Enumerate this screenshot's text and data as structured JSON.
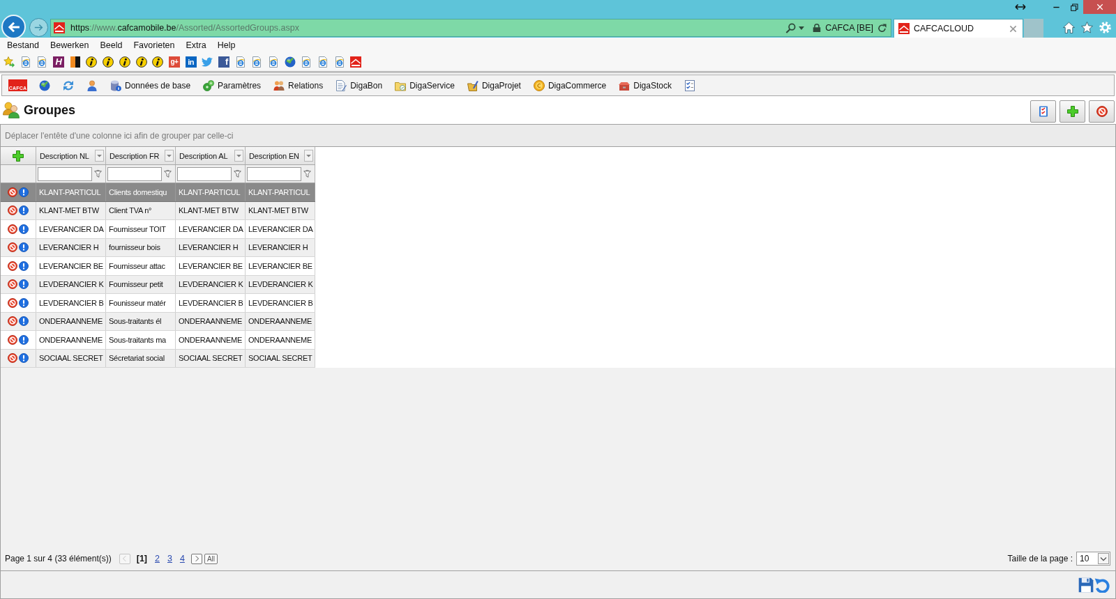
{
  "browser": {
    "address": {
      "url": [
        {
          "text": "https",
          "kind": "strong"
        },
        {
          "text": "://www.",
          "kind": "dim"
        },
        {
          "text": "cafcamobile.be",
          "kind": "strong"
        },
        {
          "text": "/Assorted/AssortedGroups.aspx",
          "kind": "dim"
        }
      ],
      "site": "CAFCA [BE]"
    },
    "tabs": [
      {
        "title": "CAFCACLOUD",
        "selected": true
      }
    ],
    "menu": [
      "Bestand",
      "Bewerken",
      "Beeld",
      "Favorieten",
      "Extra",
      "Help"
    ],
    "favorites": [
      {
        "kind": "star"
      },
      {
        "kind": "page"
      },
      {
        "kind": "page"
      },
      {
        "kind": "hotel",
        "glyph": "H"
      },
      {
        "kind": "split"
      },
      {
        "kind": "info"
      },
      {
        "kind": "info"
      },
      {
        "kind": "info"
      },
      {
        "kind": "info"
      },
      {
        "kind": "info"
      },
      {
        "kind": "gplus",
        "glyph": "g+"
      },
      {
        "kind": "linkedin",
        "glyph": "in"
      },
      {
        "kind": "twitter"
      },
      {
        "kind": "facebook",
        "glyph": "f"
      },
      {
        "kind": "page"
      },
      {
        "kind": "page"
      },
      {
        "kind": "page"
      },
      {
        "kind": "globe"
      },
      {
        "kind": "page"
      },
      {
        "kind": "page"
      },
      {
        "kind": "page"
      },
      {
        "kind": "logo"
      }
    ]
  },
  "app": {
    "logo": "CAFCA",
    "nav": [
      {
        "kind": "globe"
      },
      {
        "kind": "refresh"
      },
      {
        "kind": "user"
      },
      {
        "kind": "database",
        "label": "Données de base"
      },
      {
        "kind": "gears",
        "label": "Paramètres"
      },
      {
        "kind": "people",
        "label": "Relations"
      },
      {
        "kind": "document",
        "label": "DigaBon"
      },
      {
        "kind": "folder",
        "label": "DigaService"
      },
      {
        "kind": "project",
        "label": "DigaProjet"
      },
      {
        "kind": "coin",
        "label": "DigaCommerce"
      },
      {
        "kind": "toolbox",
        "label": "DigaStock"
      },
      {
        "kind": "checklist"
      }
    ],
    "title": "Groupes",
    "actions": [
      {
        "kind": "checklist"
      },
      {
        "kind": "add"
      },
      {
        "kind": "delete"
      }
    ],
    "group_panel": "Déplacer l'entête d'une colonne ici afin de grouper par celle-ci",
    "grid": {
      "columns": [
        "Description NL",
        "Description FR",
        "Description AL",
        "Description EN"
      ],
      "rows": [
        {
          "selected": true,
          "cells": [
            "KLANT-PARTICUL",
            "Clients domestiqu",
            "KLANT-PARTICUL",
            "KLANT-PARTICUL"
          ]
        },
        {
          "selected": false,
          "cells": [
            "KLANT-MET BTW",
            "Client TVA n°",
            "KLANT-MET BTW",
            "KLANT-MET BTW"
          ]
        },
        {
          "selected": false,
          "cells": [
            "LEVERANCIER DA",
            "Fournisseur TOIT",
            "LEVERANCIER DA",
            "LEVERANCIER DA"
          ]
        },
        {
          "selected": false,
          "cells": [
            "LEVERANCIER H",
            "fournisseur bois",
            "LEVERANCIER H",
            "LEVERANCIER H"
          ]
        },
        {
          "selected": false,
          "cells": [
            "LEVERANCIER BE",
            "Fournisseur attac",
            "LEVERANCIER BE",
            "LEVERANCIER BE"
          ]
        },
        {
          "selected": false,
          "cells": [
            "LEVDERANCIER K",
            "Fournisseur petit",
            "LEVDERANCIER K",
            "LEVDERANCIER K"
          ]
        },
        {
          "selected": false,
          "cells": [
            "LEVDERANCIER B",
            "Founisseur matér",
            "LEVDERANCIER B",
            "LEVDERANCIER B"
          ]
        },
        {
          "selected": false,
          "cells": [
            "ONDERAANNEME",
            "Sous-traitants él",
            "ONDERAANNEME",
            "ONDERAANNEME"
          ]
        },
        {
          "selected": false,
          "cells": [
            "ONDERAANNEME",
            "Sous-traitants ma",
            "ONDERAANNEME",
            "ONDERAANNEME"
          ]
        },
        {
          "selected": false,
          "cells": [
            "SOCIAAL SECRET",
            "Sécretariat social",
            "SOCIAAL SECRET",
            "SOCIAAL SECRET"
          ]
        }
      ]
    },
    "pager": {
      "summary": "Page 1 sur 4 (33 élément(s))",
      "prev": {
        "disabled": true
      },
      "pages": [
        {
          "label": "[1]",
          "selected": true
        },
        {
          "label": "2",
          "selected": false
        },
        {
          "label": "3",
          "selected": false
        },
        {
          "label": "4",
          "selected": false
        }
      ],
      "next": {
        "disabled": false
      },
      "all": "All",
      "page_size": {
        "label": "Taille de la page :",
        "value": "10"
      }
    }
  }
}
